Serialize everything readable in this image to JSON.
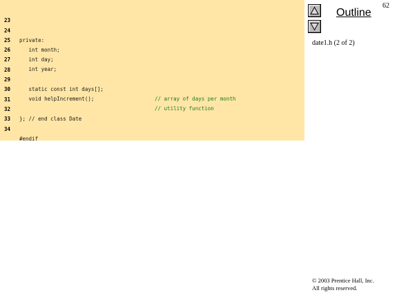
{
  "page_number": "62",
  "outline": {
    "title": "Outline",
    "up_icon": "triangle-up-icon",
    "down_icon": "triangle-down-icon"
  },
  "file_caption": "date1.h (2 of 2)",
  "code": {
    "lines": [
      {
        "num": "23",
        "text": "",
        "comment": ""
      },
      {
        "num": "24",
        "text": "private:",
        "comment": ""
      },
      {
        "num": "25",
        "text": "   int month;",
        "comment": ""
      },
      {
        "num": "26",
        "text": "   int day;",
        "comment": ""
      },
      {
        "num": "27",
        "text": "   int year;",
        "comment": ""
      },
      {
        "num": "28",
        "text": "",
        "comment": ""
      },
      {
        "num": "29",
        "text": "   static const int days[];",
        "comment": "// array of days per month"
      },
      {
        "num": "30",
        "text": "   void helpIncrement();",
        "comment": "// utility function"
      },
      {
        "num": "31",
        "text": "",
        "comment": ""
      },
      {
        "num": "32",
        "text": "}; // end class Date",
        "comment": ""
      },
      {
        "num": "33",
        "text": "",
        "comment": ""
      },
      {
        "num": "34",
        "text": "#endif",
        "comment": ""
      }
    ]
  },
  "copyright": {
    "line1": "© 2003 Prentice Hall, Inc.",
    "line2": "All rights reserved."
  },
  "colors": {
    "code_background": "#ffe6a6",
    "comment": "#1f7a1f",
    "button_face": "#bdbdbd"
  }
}
